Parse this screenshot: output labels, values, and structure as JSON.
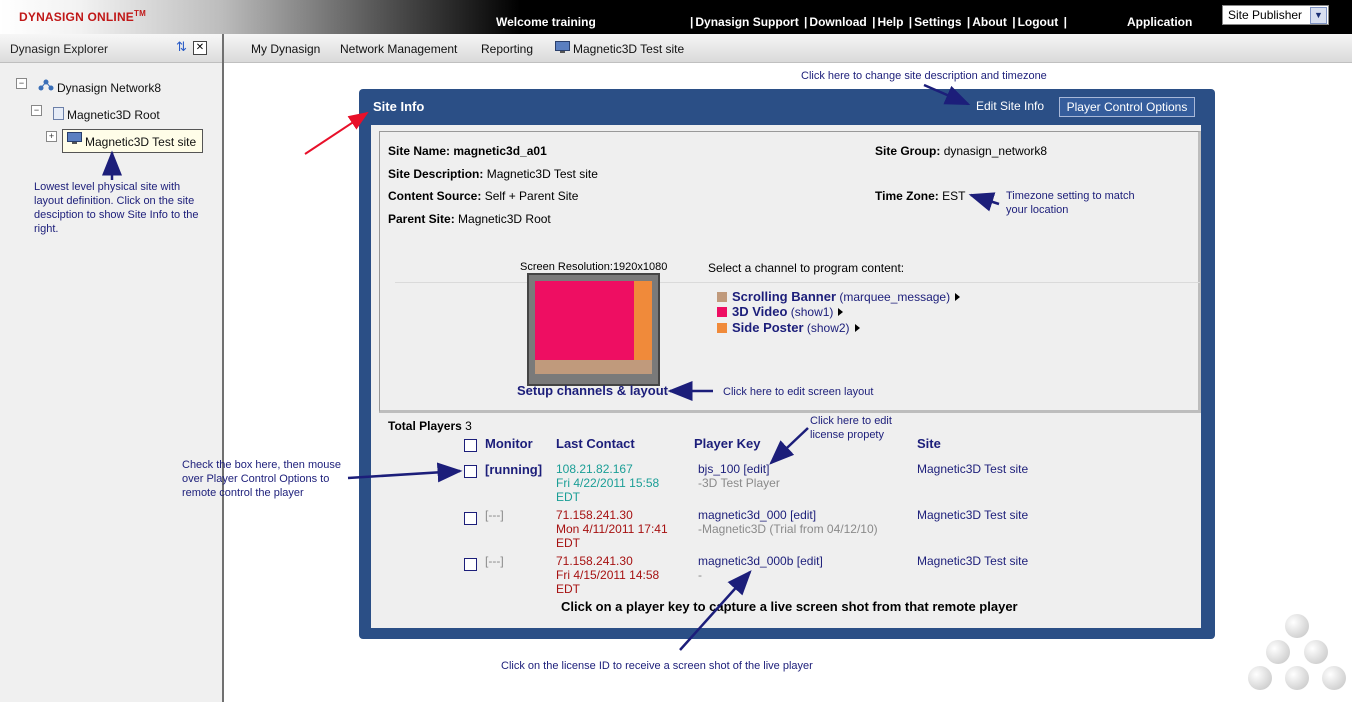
{
  "header": {
    "logo": "DYNASIGN ONLINE",
    "logo_tm": "TM",
    "welcome": "Welcome  training",
    "nav": [
      "Dynasign Support",
      "Download",
      "Help",
      "Settings",
      "About",
      "Logout"
    ],
    "application_label": "Application",
    "application_select": "Site Publisher"
  },
  "sidebar": {
    "title": "Dynasign Explorer",
    "tree": {
      "network": "Dynasign Network8",
      "root": "Magnetic3D Root",
      "site": "Magnetic3D Test site"
    },
    "annotation": "Lowest level physical site with layout definition. Click on the site desciption to show Site Info to the right."
  },
  "tabs": [
    "My Dynasign",
    "Network Management",
    "Reporting",
    "Magnetic3D Test site"
  ],
  "annotations": {
    "edit_site": "Click here to change site description and timezone",
    "timezone": "Timezone setting to match your location",
    "layout": "Click here to edit screen layout",
    "license": "Click here to edit license propety",
    "checkbox": "Check the box here, then mouse over Player Control Options to remote control the player",
    "live_shot": "Click on the license ID to receive  a screen shot of the live player"
  },
  "site_info": {
    "title": "Site Info",
    "edit_link": "Edit Site Info",
    "player_control": "Player Control Options",
    "fields": {
      "site_name_label": "Site Name:",
      "site_name": "magnetic3d_a01",
      "site_description_label": "Site Description:",
      "site_description": "Magnetic3D Test site",
      "content_source_label": "Content Source:",
      "content_source": "Self + Parent Site",
      "parent_site_label": "Parent Site:",
      "parent_site": "Magnetic3D Root",
      "site_group_label": "Site Group:",
      "site_group": "dynasign_network8",
      "time_zone_label": "Time Zone:",
      "time_zone": "EST"
    },
    "screen_resolution": "Screen Resolution:1920x1080",
    "channel_prompt": "Select a channel to program content:",
    "channels": [
      {
        "name": "Scrolling Banner",
        "tag": "(marquee_message)",
        "color": "#c09a7c"
      },
      {
        "name": "3D Video",
        "tag": "(show1)",
        "color": "#ee0e62"
      },
      {
        "name": "Side Poster",
        "tag": "(show2)",
        "color": "#f08a3a"
      }
    ],
    "setup_link": "Setup channels & layout"
  },
  "players": {
    "total_label": "Total Players",
    "total": "3",
    "columns": [
      "Monitor",
      "Last Contact",
      "Player Key",
      "Site"
    ],
    "rows": [
      {
        "monitor": "[running]",
        "ip": "108.21.82.167",
        "date": "Fri 4/22/2011 15:58",
        "tz": "EDT",
        "key": "bjs_100",
        "edit": "[edit]",
        "note": "-3D Test Player",
        "site": "Magnetic3D Test site"
      },
      {
        "monitor": "[---]",
        "ip": "71.158.241.30",
        "date": "Mon 4/11/2011 17:41",
        "tz": "EDT",
        "key": "magnetic3d_000",
        "edit": "[edit]",
        "note": "-Magnetic3D (Trial from 04/12/10)",
        "site": "Magnetic3D Test site"
      },
      {
        "monitor": "[---]",
        "ip": "71.158.241.30",
        "date": "Fri 4/15/2011 14:58",
        "tz": "EDT",
        "key": "magnetic3d_000b",
        "edit": "[edit]",
        "note": "-",
        "site": "Magnetic3D Test site"
      }
    ],
    "footer": "Click on a player key to capture a live screen shot from that remote player"
  }
}
